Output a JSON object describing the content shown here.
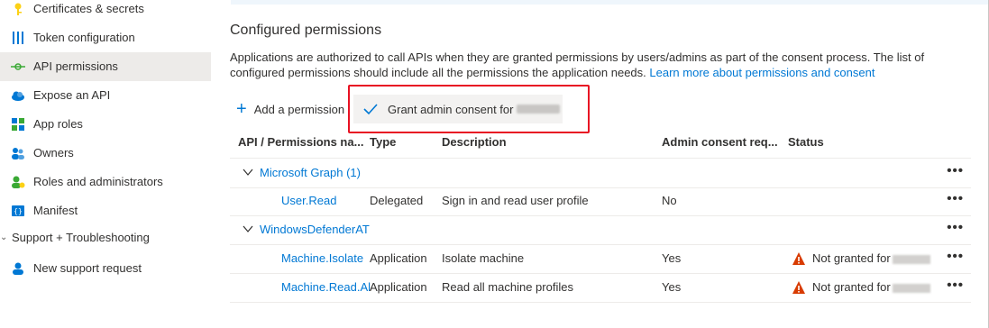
{
  "sidebar": {
    "items": [
      {
        "label": "Certificates & secrets",
        "icon": "key-icon"
      },
      {
        "label": "Token configuration",
        "icon": "bars-icon"
      },
      {
        "label": "API permissions",
        "icon": "api-permissions-icon",
        "active": true
      },
      {
        "label": "Expose an API",
        "icon": "cloud-icon"
      },
      {
        "label": "App roles",
        "icon": "grid-icon"
      },
      {
        "label": "Owners",
        "icon": "owners-icon"
      },
      {
        "label": "Roles and administrators",
        "icon": "person-role-icon"
      },
      {
        "label": "Manifest",
        "icon": "manifest-icon"
      }
    ],
    "section": "Support + Troubleshooting",
    "support_item": {
      "label": "New support request",
      "icon": "person-support-icon"
    }
  },
  "main": {
    "title": "Configured permissions",
    "description": "Applications are authorized to call APIs when they are granted permissions by users/admins as part of the consent process. The list of configured permissions should include all the permissions the application needs.",
    "learn_more": "Learn more about permissions and consent",
    "add_permission": "Add a permission",
    "grant_consent": "Grant admin consent for"
  },
  "table": {
    "headers": [
      "API / Permissions na...",
      "Type",
      "Description",
      "Admin consent req...",
      "Status"
    ],
    "groups": [
      {
        "name": "Microsoft Graph (1)",
        "rows": [
          {
            "api": "User.Read",
            "type": "Delegated",
            "description": "Sign in and read user profile",
            "admin": "No",
            "status": ""
          }
        ]
      },
      {
        "name": "WindowsDefenderAT",
        "rows": [
          {
            "api": "Machine.Isolate",
            "type": "Application",
            "description": "Isolate machine",
            "admin": "Yes",
            "status": "Not granted for"
          },
          {
            "api": "Machine.Read.Al",
            "type": "Application",
            "description": "Read all machine profiles",
            "admin": "Yes",
            "status": "Not granted for"
          }
        ]
      }
    ],
    "more": "•••"
  },
  "colors": {
    "accent": "#0078d4",
    "highlight_border": "#e81123",
    "warning": "#d83b01"
  }
}
